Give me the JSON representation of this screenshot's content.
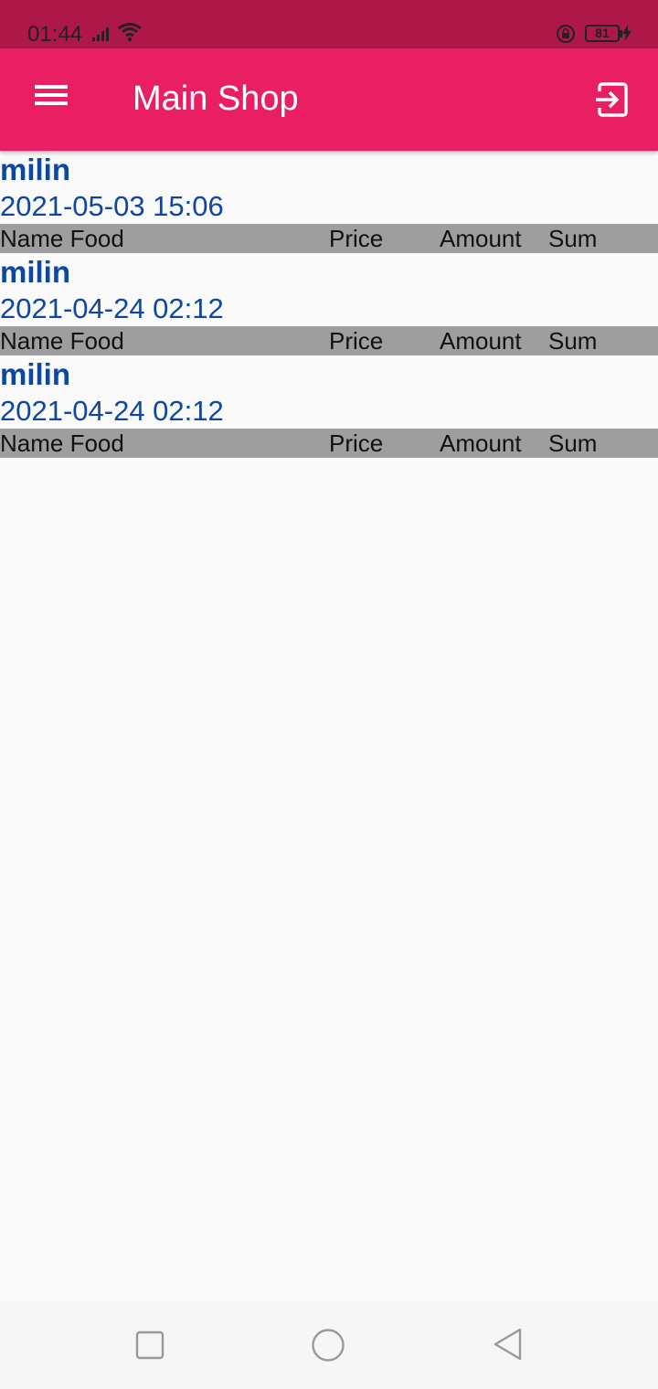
{
  "status_bar": {
    "time": "01:44",
    "battery": "81"
  },
  "app_bar": {
    "title": "Main Shop"
  },
  "orders": [
    {
      "name": "milin",
      "date": "2021-05-03 15:06",
      "columns": {
        "name": "Name Food",
        "price": "Price",
        "amount": "Amount",
        "sum": "Sum"
      }
    },
    {
      "name": "milin",
      "date": "2021-04-24 02:12",
      "columns": {
        "name": "Name Food",
        "price": "Price",
        "amount": "Amount",
        "sum": "Sum"
      }
    },
    {
      "name": "milin",
      "date": "2021-04-24 02:12",
      "columns": {
        "name": "Name Food",
        "price": "Price",
        "amount": "Amount",
        "sum": "Sum"
      }
    }
  ],
  "colors": {
    "status_bar": "#ad1848",
    "app_bar": "#e91e63",
    "order_text": "#0d47a1",
    "header_row": "#9e9e9e"
  },
  "icons": {
    "menu": "menu-icon",
    "exit": "exit-icon",
    "recents": "square-icon",
    "home": "circle-icon",
    "back": "triangle-back-icon"
  }
}
